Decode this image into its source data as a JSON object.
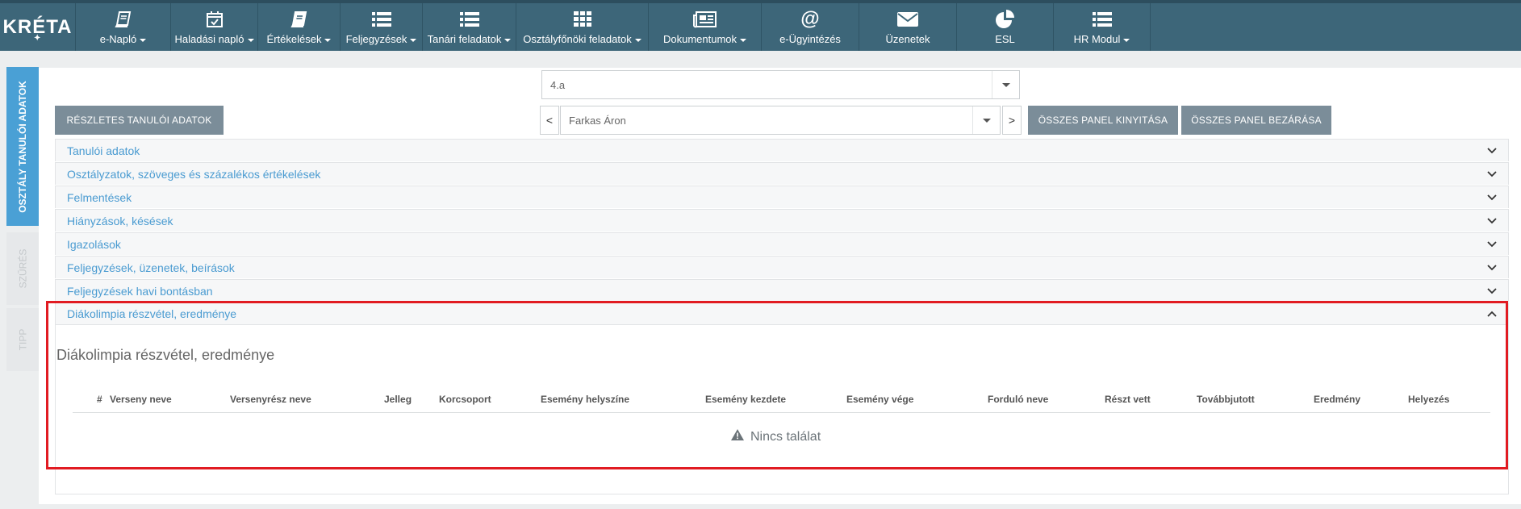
{
  "app": {
    "logo_text": "KRÉTA"
  },
  "nav": [
    {
      "label": "e-Napló",
      "icon": "book-icon",
      "dropdown": true
    },
    {
      "label": "Haladási napló",
      "icon": "calendar-check-icon",
      "dropdown": true
    },
    {
      "label": "Értékelések",
      "icon": "book-icon",
      "dropdown": true
    },
    {
      "label": "Feljegyzések",
      "icon": "list-icon",
      "dropdown": true
    },
    {
      "label": "Tanári feladatok",
      "icon": "list-icon",
      "dropdown": true
    },
    {
      "label": "Osztályfőnöki feladatok",
      "icon": "grid-icon",
      "dropdown": true
    },
    {
      "label": "Dokumentumok",
      "icon": "newspaper-icon",
      "dropdown": true
    },
    {
      "label": "e-Ügyintézés",
      "icon": "at-icon",
      "dropdown": false
    },
    {
      "label": "Üzenetek",
      "icon": "envelope-icon",
      "dropdown": false
    },
    {
      "label": "ESL",
      "icon": "pie-chart-icon",
      "dropdown": false
    },
    {
      "label": "HR Modul",
      "icon": "list-icon",
      "dropdown": true
    }
  ],
  "side_tabs": {
    "active": "OSZTÁLY TANULÓI ADATOK",
    "filter": "SZŰRÉS",
    "tip": "TIPP"
  },
  "toolbar": {
    "class_select": "4.a",
    "detailed_btn": "RÉSZLETES TANULÓI ADATOK",
    "student_select": "Farkas Áron",
    "prev": "<",
    "next": ">",
    "expand_all": "ÖSSZES PANEL KINYITÁSA",
    "collapse_all": "ÖSSZES PANEL BEZÁRÁSA"
  },
  "panels": [
    {
      "title": "Tanulói adatok",
      "expanded": false
    },
    {
      "title": "Osztályzatok, szöveges és százalékos értékelések",
      "expanded": false
    },
    {
      "title": "Felmentések",
      "expanded": false
    },
    {
      "title": "Hiányzások, késések",
      "expanded": false
    },
    {
      "title": "Igazolások",
      "expanded": false
    },
    {
      "title": "Feljegyzések, üzenetek, beírások",
      "expanded": false
    },
    {
      "title": "Feljegyzések havi bontásban",
      "expanded": false
    },
    {
      "title": "Diákolimpia részvétel, eredménye",
      "expanded": true
    }
  ],
  "section": {
    "title": "Diákolimpia részvétel, eredménye",
    "columns": [
      "#",
      "Verseny neve",
      "Versenyrész neve",
      "Jelleg",
      "Korcsoport",
      "Esemény helyszíne",
      "Esemény kezdete",
      "Esemény vége",
      "Forduló neve",
      "Részt vett",
      "Továbbjutott",
      "Eredmény",
      "Helyezés"
    ],
    "empty_text": "Nincs találat"
  },
  "colors": {
    "topbar": "#3d6679",
    "accent": "#4aa0d5",
    "button": "#7b8d99",
    "highlight": "#e11b22"
  }
}
